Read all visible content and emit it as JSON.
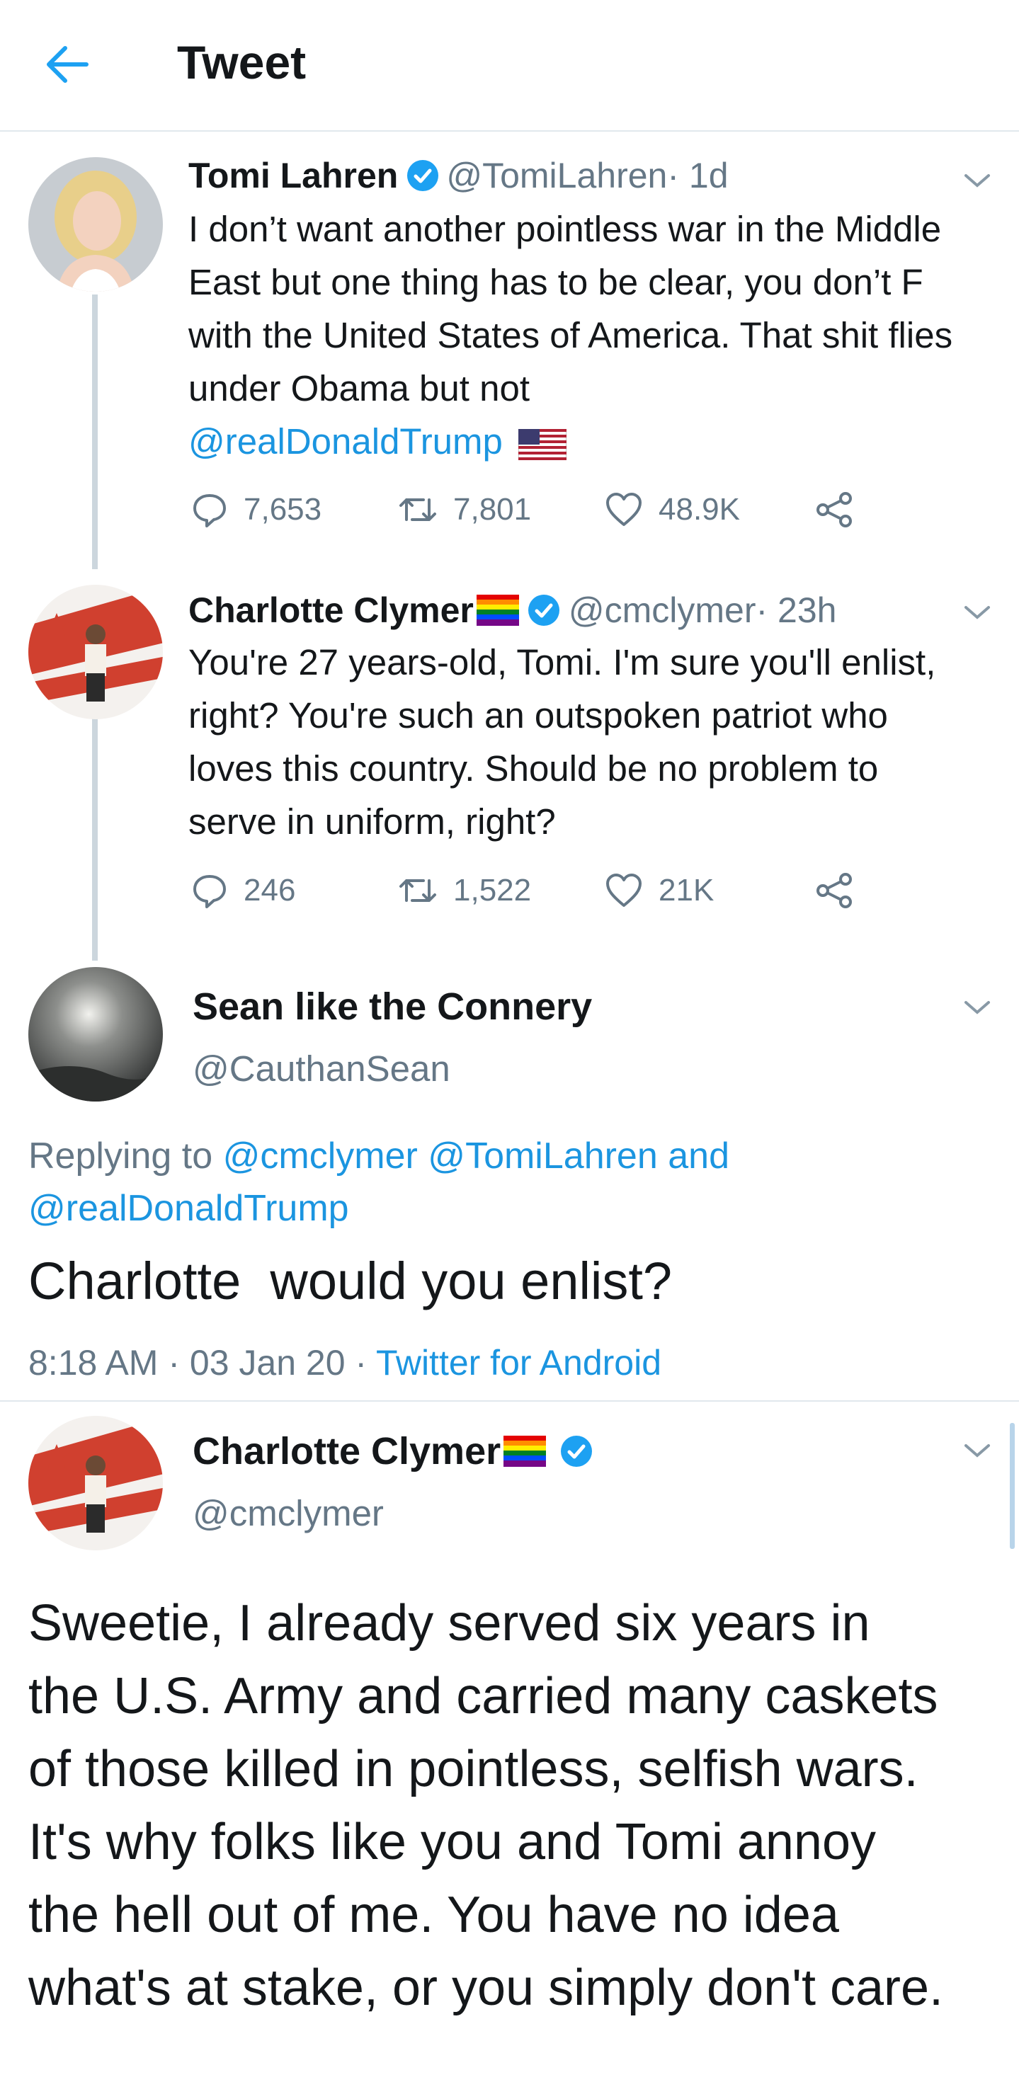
{
  "header": {
    "title": "Tweet"
  },
  "tweets": [
    {
      "name": "Tomi Lahren",
      "handle": "@TomiLahren",
      "time": " · 1d",
      "text": "I don’t want another pointless war in the Middle East but one thing has to be clear, you don’t F with the United States of America. That shit flies under Obama but not",
      "mention": "@realDonaldTrump",
      "replies": "7,653",
      "retweets": "7,801",
      "likes": "48.9K"
    },
    {
      "name": "Charlotte Clymer",
      "handle": "@cmclymer",
      "time": " · 23h",
      "text": "You're 27 years-old, Tomi. I'm sure you'll enlist, right? You're such an outspoken patriot who loves this country. Should be no problem to serve in uniform, right?",
      "replies": "246",
      "retweets": "1,522",
      "likes": "21K"
    }
  ],
  "focus": {
    "name": "Sean like the Connery",
    "handle": "@CauthanSean",
    "replying_prefix": "Replying to ",
    "replying_to_1": "@cmclymer",
    "replying_to_2": "@TomiLahren",
    "replying_and": " and",
    "replying_to_3": "@realDonaldTrump",
    "text": "Charlotte  would you enlist?",
    "timestamp": "8:18 AM · 03 Jan 20 · ",
    "source": "Twitter for Android"
  },
  "reply": {
    "name": "Charlotte Clymer",
    "handle": "@cmclymer",
    "text": "Sweetie, I already served six years in the U.S. Army and carried many caskets of those killed in pointless, selfish wars. It's why folks like you and Tomi annoy the hell out of me. You have no idea what's at stake, or you simply don't care."
  },
  "colors": {
    "link": "#1b95e0",
    "secondary": "#657786",
    "verified": "#1da1f2",
    "divider": "#e1e8ed"
  },
  "icons": [
    "back-arrow-icon",
    "verified-icon",
    "pride-flag-icon",
    "us-flag-icon",
    "chevron-down-icon",
    "reply-icon",
    "retweet-icon",
    "like-icon",
    "share-icon"
  ]
}
